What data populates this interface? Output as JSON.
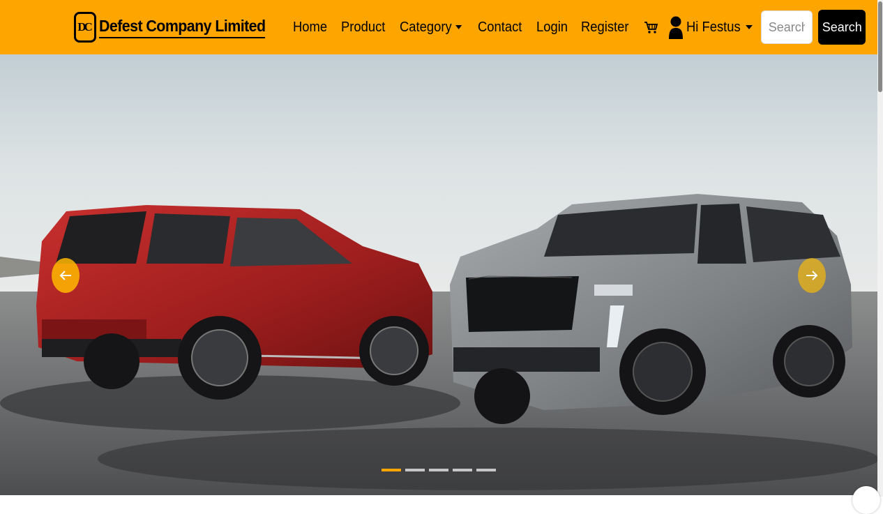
{
  "brand": {
    "logo_text": "DC",
    "name": "Defest Company Limited"
  },
  "nav": {
    "home": "Home",
    "product": "Product",
    "category": "Category",
    "contact": "Contact",
    "login": "Login",
    "register": "Register",
    "user_greeting": "Hi Festus"
  },
  "search": {
    "placeholder": "Search",
    "button_label": "Search"
  },
  "carousel": {
    "slide_count": 5,
    "active_index": 0
  },
  "colors": {
    "accent": "#FFA500",
    "button_bg": "#000000"
  }
}
